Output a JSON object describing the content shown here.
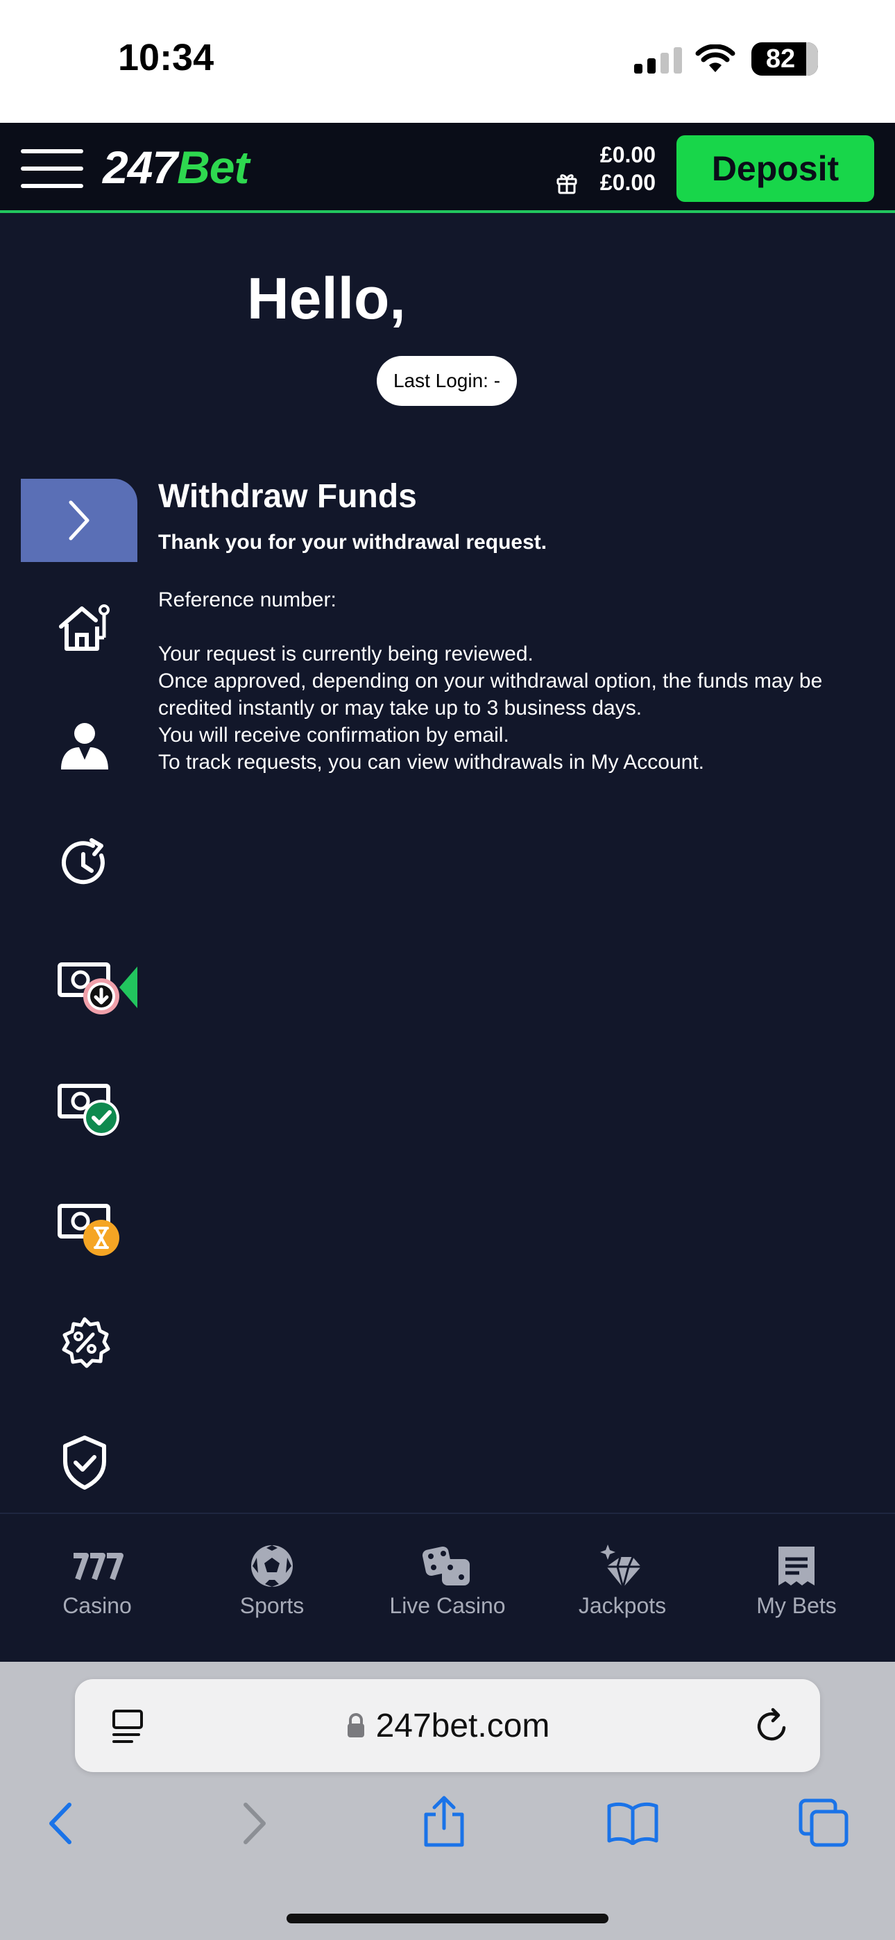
{
  "status_bar": {
    "time": "10:34",
    "battery": "82"
  },
  "header": {
    "logo_number": "247",
    "logo_bet": "Bet",
    "cash_balance": "£0.00",
    "bonus_balance": "£0.00",
    "deposit_label": "Deposit"
  },
  "greeting": {
    "hello": "Hello,",
    "last_login": "Last Login: -"
  },
  "sidebar": {
    "items": [
      {
        "icon": "casino-home-icon"
      },
      {
        "icon": "account-icon"
      },
      {
        "icon": "history-icon"
      },
      {
        "icon": "withdraw-funds-icon",
        "active": true
      },
      {
        "icon": "approved-withdrawal-icon"
      },
      {
        "icon": "pending-withdrawal-icon"
      },
      {
        "icon": "promotions-icon"
      },
      {
        "icon": "safer-gambling-icon"
      }
    ]
  },
  "content": {
    "title": "Withdraw Funds",
    "thanks": "Thank you for your withdrawal request.",
    "reference": "Reference number:",
    "lines": [
      "Your request is currently being reviewed.",
      "Once approved, depending on your withdrawal option, the funds may be credited instantly or may take up to 3 business days.",
      "You will receive confirmation by email.",
      "To track requests, you can view withdrawals in My Account."
    ]
  },
  "bottom_nav": {
    "items": [
      {
        "label": "Casino",
        "icon": "slots-777-icon"
      },
      {
        "label": "Sports",
        "icon": "soccer-ball-icon"
      },
      {
        "label": "Live Casino",
        "icon": "dice-icon"
      },
      {
        "label": "Jackpots",
        "icon": "diamond-icon"
      },
      {
        "label": "My Bets",
        "icon": "bet-slip-icon"
      }
    ]
  },
  "browser": {
    "url": "247bet.com"
  },
  "colors": {
    "accent_green": "#18d64a",
    "background": "#12172a",
    "sidebar_active": "#5a6fb6"
  }
}
